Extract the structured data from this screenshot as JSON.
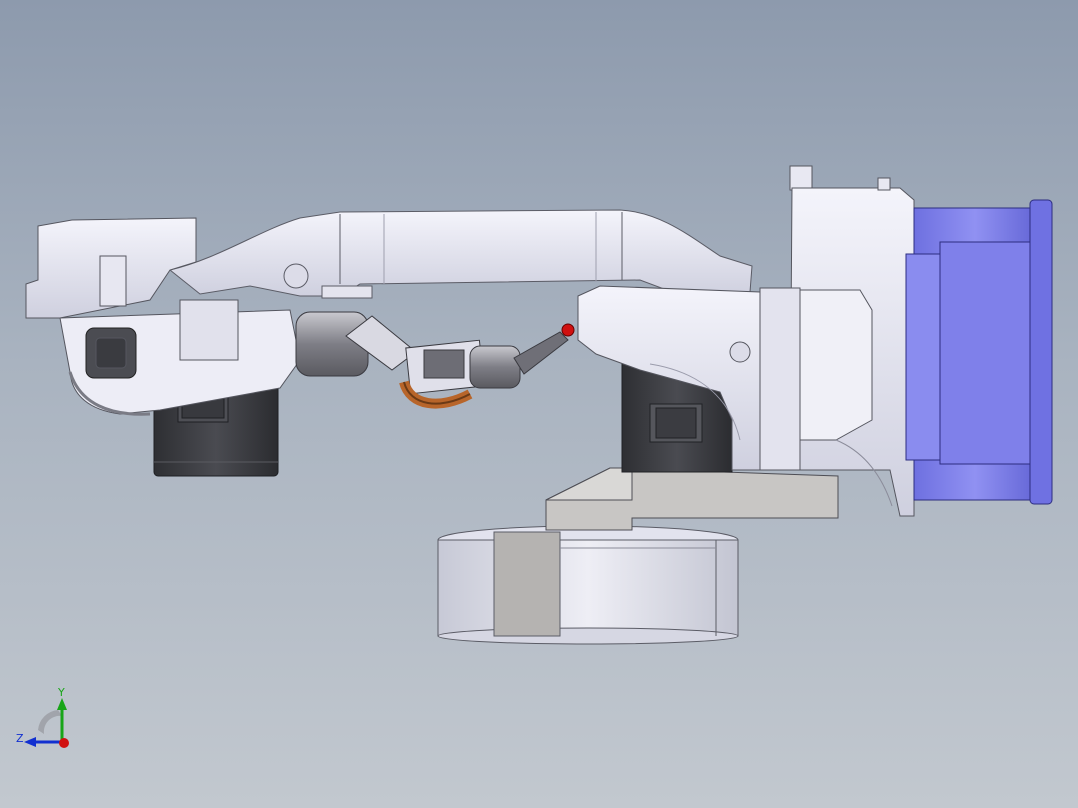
{
  "viewport": {
    "background_top": "#8d9aad",
    "background_bottom": "#c2c8cf"
  },
  "model": {
    "parts": {
      "body_color": "#e9e9f3",
      "shade_color": "#c9cad8",
      "motor_color": "#3c3d42",
      "base_plate_color": "#c8c6c4",
      "end_motor_color": "#7f80ea",
      "torch_color": "#8a8a90",
      "cable_color": "#b8652a",
      "tip_color": "#d01010"
    }
  },
  "triad": {
    "x_axis_color": "#d01010",
    "y_axis_color": "#18a518",
    "z_axis_color": "#1230d0",
    "y_label": "Y",
    "z_label": "Z"
  }
}
